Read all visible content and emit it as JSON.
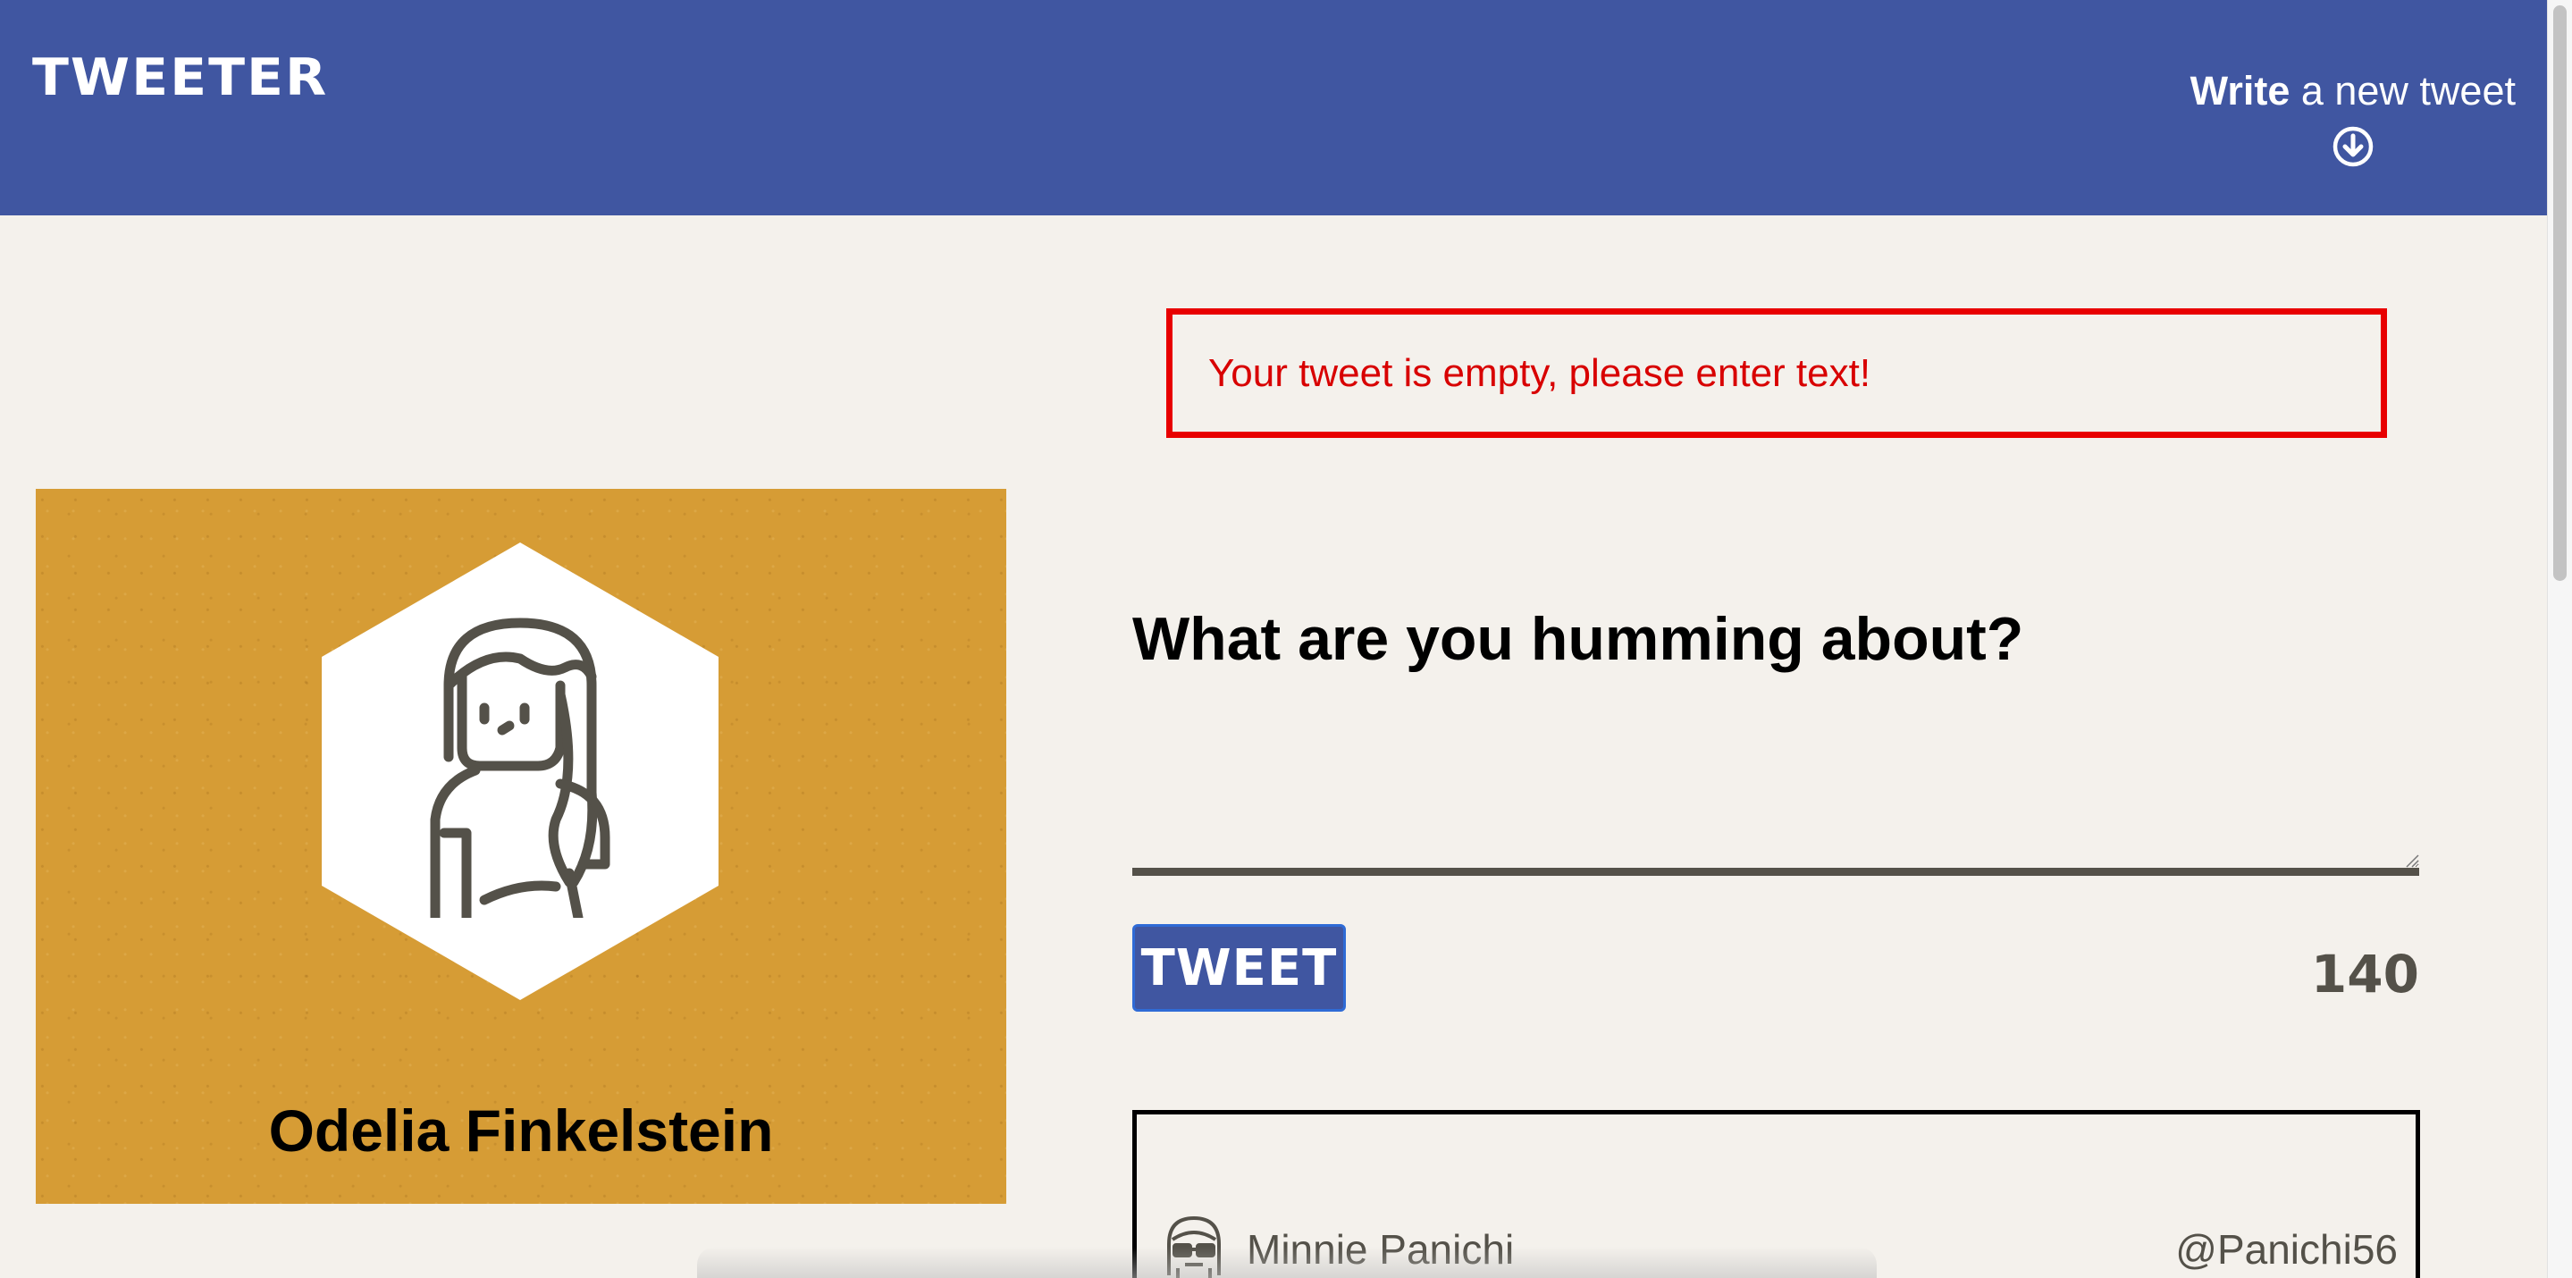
{
  "nav": {
    "brand": "TWEETER",
    "compose_toggle_bold": "Write",
    "compose_toggle_rest": " a new tweet",
    "compose_toggle_icon": "arrow-down-circle-icon"
  },
  "profile": {
    "name": "Odelia Finkelstein",
    "avatar_icon": "female-avatar-icon",
    "card_color": "#d69c35"
  },
  "error": {
    "message": "Your tweet is empty, please enter text!",
    "color": "#e80000"
  },
  "compose": {
    "heading": "What are you humming about?",
    "textarea_value": "",
    "button_label": "TWEET",
    "char_counter": "140"
  },
  "tweets": [
    {
      "author": "Minnie Panichi",
      "handle": "@Panichi56",
      "avatar_icon": "avatar-with-sunglasses-icon"
    }
  ],
  "colors": {
    "header_bg": "#4056a1",
    "page_bg": "#f4f1ec",
    "counter": "#545149"
  }
}
